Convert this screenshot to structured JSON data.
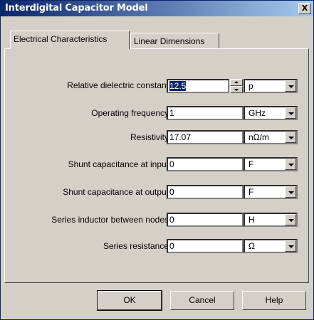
{
  "window": {
    "title": "Interdigital Capacitor Model"
  },
  "tabs": [
    {
      "label": "Electrical Characteristics"
    },
    {
      "label": "Linear Dimensions"
    }
  ],
  "rows": [
    {
      "label": "Relative dielectric constant",
      "value": "12.5",
      "unit": "p"
    },
    {
      "label": "Operating frequency",
      "value": "1",
      "unit": "GHz"
    },
    {
      "label": "Resistivity",
      "value": "17.07",
      "unit": "nΩ/m"
    },
    {
      "label": "Shunt capacitance at input",
      "value": "0",
      "unit": "F"
    },
    {
      "label": "Shunt capacitance at output",
      "value": "0",
      "unit": "F"
    },
    {
      "label": "Series inductor between nodes",
      "value": "0",
      "unit": "H"
    },
    {
      "label": "Series resistance",
      "value": "0",
      "unit": "Ω"
    }
  ],
  "buttons": {
    "ok": "OK",
    "cancel": "Cancel",
    "help": "Help"
  },
  "close_glyph": "X"
}
